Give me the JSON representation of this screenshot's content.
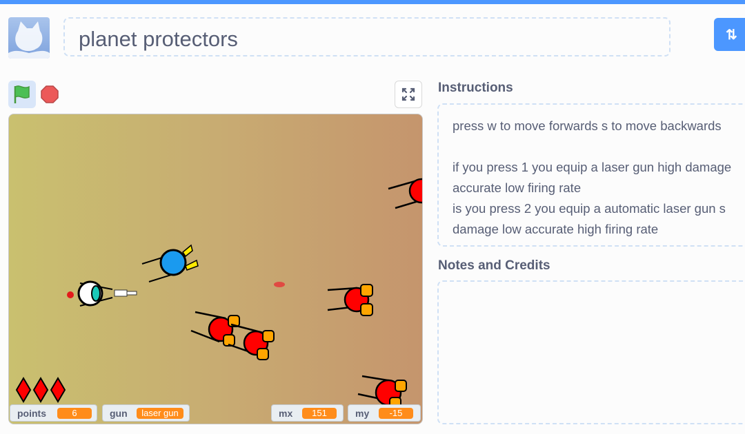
{
  "header": {
    "title": "planet protectors",
    "remix_icon": "remix-icon"
  },
  "controls": {
    "flag_icon": "green-flag-icon",
    "stop_icon": "stop-icon",
    "fullscreen_icon": "fullscreen-icon"
  },
  "stage": {
    "lives": 3,
    "monitors": [
      {
        "label": "points",
        "value": "6"
      },
      {
        "label": "gun",
        "value": "laser gun"
      },
      {
        "label": "mx",
        "value": "151"
      },
      {
        "label": "my",
        "value": "-15"
      }
    ]
  },
  "instructions": {
    "title": "Instructions",
    "lines": [
      "press w to move forwards s to move backwards",
      "",
      "if you press 1 you equip a laser gun high damage",
      "accurate low firing rate",
      "is you press 2 you equip a automatic laser gun s",
      "damage low accurate high firing rate"
    ]
  },
  "notes": {
    "title": "Notes and Credits"
  },
  "colors": {
    "accent": "#4c97ff",
    "monitor_value": "#ff8c1a",
    "enemy": "#ff0000",
    "enemy_thruster": "#ffa500"
  }
}
